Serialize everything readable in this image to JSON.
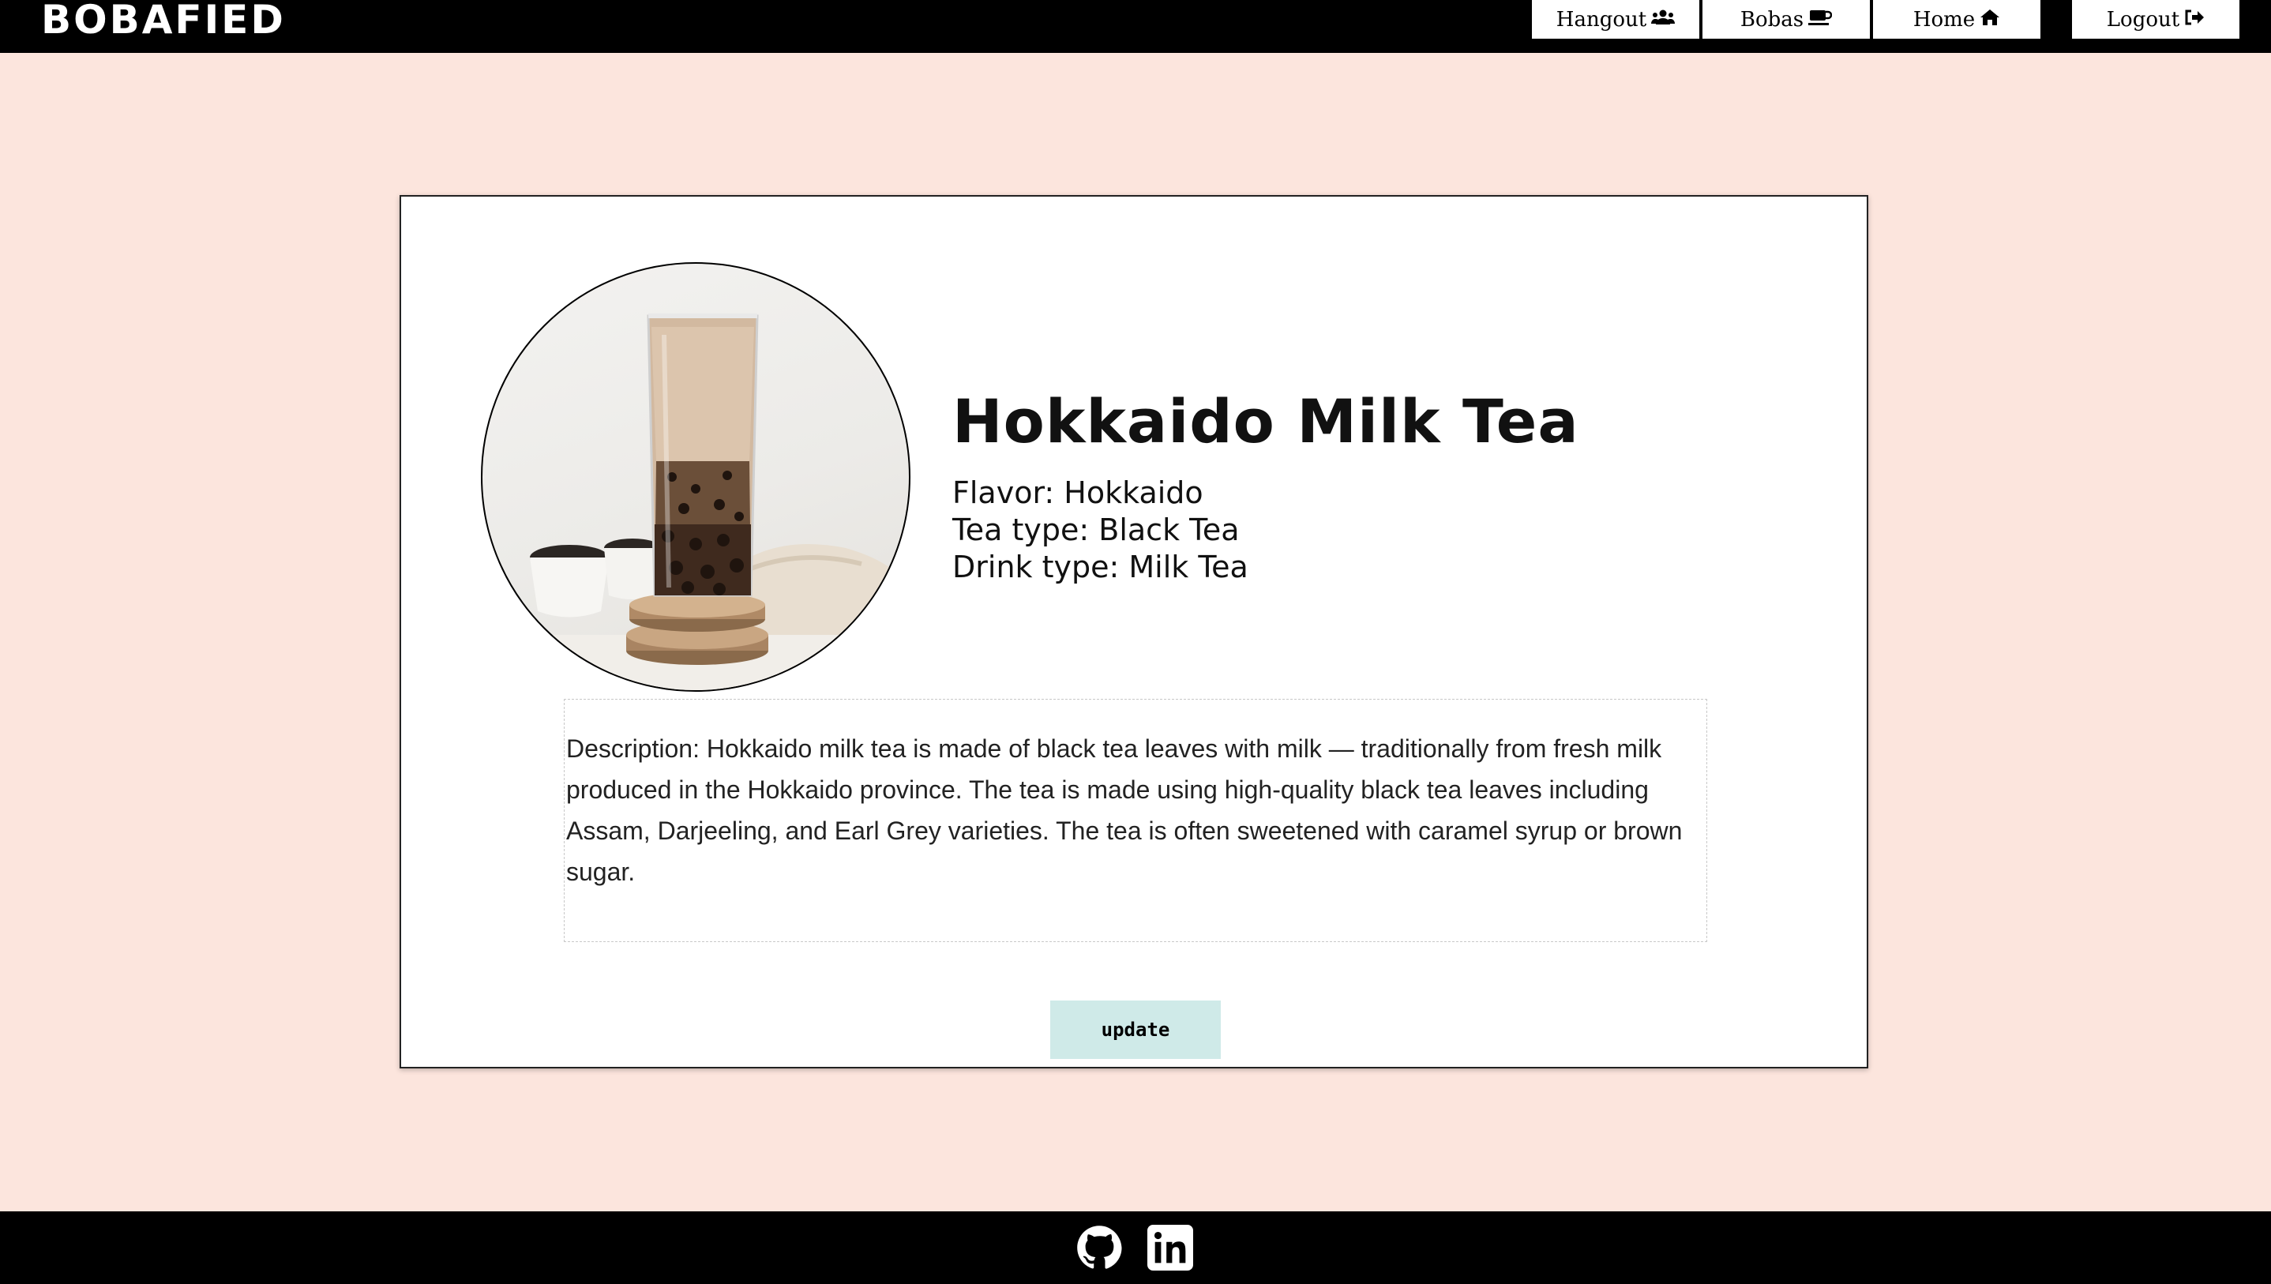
{
  "brand": {
    "logo": "BOBAFIED"
  },
  "nav": {
    "hangout": "Hangout",
    "bobas": "Bobas",
    "home": "Home",
    "logout": "Logout"
  },
  "drink": {
    "name": "Hokkaido Milk Tea",
    "flavor": "Flavor: Hokkaido",
    "tea_type": "Tea type: Black Tea",
    "drink_type": "Drink type: Milk Tea",
    "description": "Description: Hokkaido milk tea is made of black tea leaves with milk — traditionally from fresh milk produced in the Hokkaido province. The tea is made using high-quality black tea leaves including Assam, Darjeeling, and Earl Grey varieties. The tea is often sweetened with caramel syrup or brown sugar."
  },
  "actions": {
    "update_label": "update"
  },
  "footer": {
    "icons": [
      "github-icon",
      "linkedin-icon"
    ]
  },
  "colors": {
    "background": "#fce5dd",
    "bar": "#000000",
    "update_button": "#cfeae8"
  }
}
